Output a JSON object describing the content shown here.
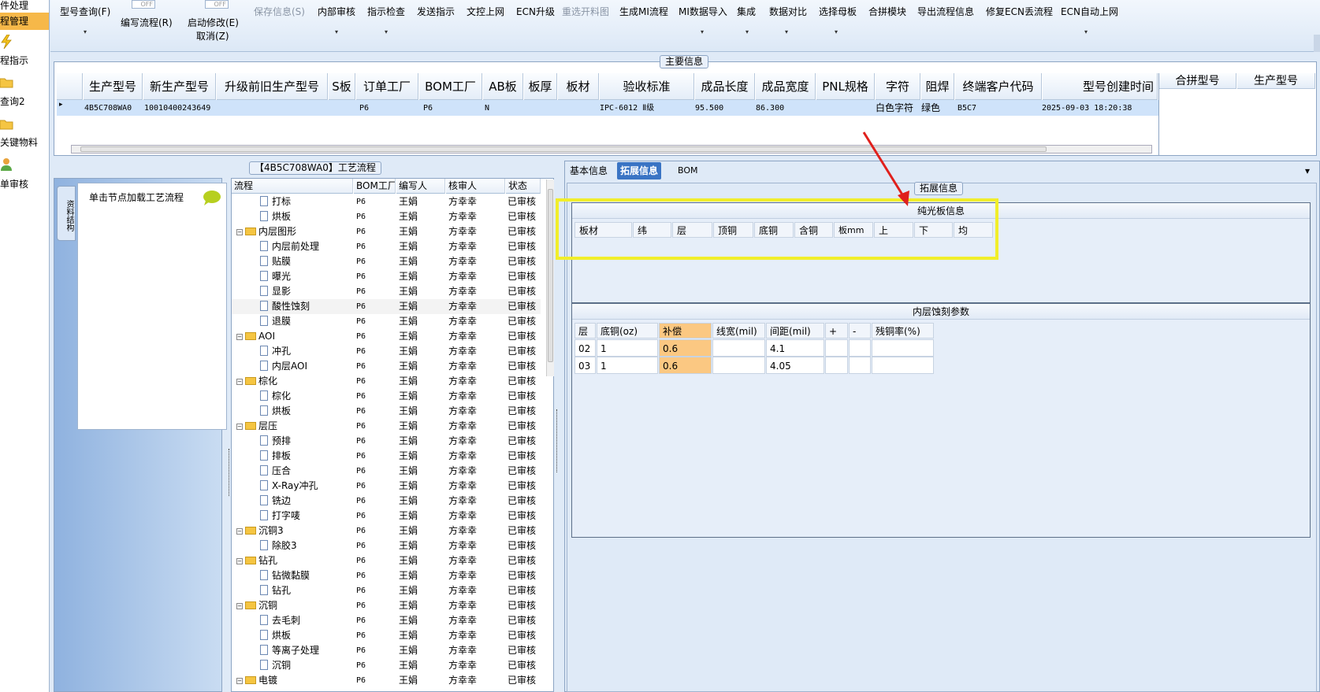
{
  "leftnav": {
    "items": [
      "件处理",
      "程管理",
      "程指示",
      "查询2",
      "关键物料",
      "单审核"
    ]
  },
  "toolbar": {
    "items": [
      {
        "label": "型号查询(F)"
      },
      {
        "label": "OFF"
      },
      {
        "label": "编写流程(R)"
      },
      {
        "label": "OFF"
      },
      {
        "label": "启动修改(E)"
      },
      {
        "label": "取消(Z)"
      },
      {
        "label": "保存信息(S)",
        "disabled": true
      },
      {
        "label": "内部审核"
      },
      {
        "label": "指示检查"
      },
      {
        "label": "发送指示"
      },
      {
        "label": "文控上网"
      },
      {
        "label": "ECN升级"
      },
      {
        "label": "重选开料图",
        "disabled": true
      },
      {
        "label": "生成MI流程"
      },
      {
        "label": "MI数据导入"
      },
      {
        "label": "集成"
      },
      {
        "label": "数据对比"
      },
      {
        "label": "选择母板"
      },
      {
        "label": "合拼模块"
      },
      {
        "label": "导出流程信息"
      },
      {
        "label": "修复ECN丢流程"
      },
      {
        "label": "ECN自动上网"
      }
    ],
    "dropdown_glyph": "▾"
  },
  "main_info": {
    "title": "主要信息",
    "columns": [
      "生产型号",
      "新生产型号",
      "升级前旧生产型号",
      "S板",
      "订单工厂",
      "BOM工厂",
      "AB板",
      "板厚",
      "板材",
      "验收标准",
      "成品长度",
      "成品宽度",
      "PNL规格",
      "字符",
      "阻焊",
      "终端客户代码",
      "型号创建时间"
    ],
    "row": [
      "4B5C708WA0",
      "10010400243649",
      "",
      "",
      "P6",
      "P6",
      "N",
      "",
      "",
      "IPC-6012 Ⅱ级",
      "95.500",
      "86.300",
      "",
      "白色字符",
      "绿色",
      "B5C7",
      "2025-09-03 18:20:38"
    ],
    "row_indicator": "▸",
    "side_columns": [
      "合拼型号",
      "生产型号"
    ]
  },
  "process": {
    "title": "【4B5C708WA0】工艺流程",
    "side_tab": "资料结构",
    "hint": "单击节点加载工艺流程",
    "columns": [
      "流程",
      "BOM工厂",
      "编写人",
      "核审人",
      "状态"
    ],
    "rows": [
      {
        "name": "打标",
        "type": "doc",
        "level": 2,
        "bom": "P6",
        "writer": "王娟",
        "reviewer": "方幸幸",
        "status": "已审核"
      },
      {
        "name": "烘板",
        "type": "doc",
        "level": 2,
        "bom": "P6",
        "writer": "王娟",
        "reviewer": "方幸幸",
        "status": "已审核"
      },
      {
        "name": "内层图形",
        "type": "folder",
        "level": 1,
        "bom": "P6",
        "writer": "王娟",
        "reviewer": "方幸幸",
        "status": "已审核"
      },
      {
        "name": "内层前处理",
        "type": "doc",
        "level": 2,
        "bom": "P6",
        "writer": "王娟",
        "reviewer": "方幸幸",
        "status": "已审核"
      },
      {
        "name": "贴膜",
        "type": "doc",
        "level": 2,
        "bom": "P6",
        "writer": "王娟",
        "reviewer": "方幸幸",
        "status": "已审核"
      },
      {
        "name": "曝光",
        "type": "doc",
        "level": 2,
        "bom": "P6",
        "writer": "王娟",
        "reviewer": "方幸幸",
        "status": "已审核"
      },
      {
        "name": "显影",
        "type": "doc",
        "level": 2,
        "bom": "P6",
        "writer": "王娟",
        "reviewer": "方幸幸",
        "status": "已审核"
      },
      {
        "name": "酸性蚀刻",
        "type": "doc",
        "level": 2,
        "bom": "P6",
        "writer": "王娟",
        "reviewer": "方幸幸",
        "status": "已审核",
        "selected": true
      },
      {
        "name": "退膜",
        "type": "doc",
        "level": 2,
        "bom": "P6",
        "writer": "王娟",
        "reviewer": "方幸幸",
        "status": "已审核"
      },
      {
        "name": "AOI",
        "type": "folder",
        "level": 1,
        "bom": "P6",
        "writer": "王娟",
        "reviewer": "方幸幸",
        "status": "已审核"
      },
      {
        "name": "冲孔",
        "type": "doc",
        "level": 2,
        "bom": "P6",
        "writer": "王娟",
        "reviewer": "方幸幸",
        "status": "已审核"
      },
      {
        "name": "内层AOI",
        "type": "doc",
        "level": 2,
        "bom": "P6",
        "writer": "王娟",
        "reviewer": "方幸幸",
        "status": "已审核"
      },
      {
        "name": "棕化",
        "type": "folder",
        "level": 1,
        "bom": "P6",
        "writer": "王娟",
        "reviewer": "方幸幸",
        "status": "已审核"
      },
      {
        "name": "棕化",
        "type": "doc",
        "level": 2,
        "bom": "P6",
        "writer": "王娟",
        "reviewer": "方幸幸",
        "status": "已审核"
      },
      {
        "name": "烘板",
        "type": "doc",
        "level": 2,
        "bom": "P6",
        "writer": "王娟",
        "reviewer": "方幸幸",
        "status": "已审核"
      },
      {
        "name": "层压",
        "type": "folder",
        "level": 1,
        "bom": "P6",
        "writer": "王娟",
        "reviewer": "方幸幸",
        "status": "已审核"
      },
      {
        "name": "预排",
        "type": "doc",
        "level": 2,
        "bom": "P6",
        "writer": "王娟",
        "reviewer": "方幸幸",
        "status": "已审核"
      },
      {
        "name": "排板",
        "type": "doc",
        "level": 2,
        "bom": "P6",
        "writer": "王娟",
        "reviewer": "方幸幸",
        "status": "已审核"
      },
      {
        "name": "压合",
        "type": "doc",
        "level": 2,
        "bom": "P6",
        "writer": "王娟",
        "reviewer": "方幸幸",
        "status": "已审核"
      },
      {
        "name": "X-Ray冲孔",
        "type": "doc",
        "level": 2,
        "bom": "P6",
        "writer": "王娟",
        "reviewer": "方幸幸",
        "status": "已审核"
      },
      {
        "name": "铣边",
        "type": "doc",
        "level": 2,
        "bom": "P6",
        "writer": "王娟",
        "reviewer": "方幸幸",
        "status": "已审核"
      },
      {
        "name": "打字唛",
        "type": "doc",
        "level": 2,
        "bom": "P6",
        "writer": "王娟",
        "reviewer": "方幸幸",
        "status": "已审核"
      },
      {
        "name": "沉铜3",
        "type": "folder",
        "level": 1,
        "bom": "P6",
        "writer": "王娟",
        "reviewer": "方幸幸",
        "status": "已审核"
      },
      {
        "name": "除胶3",
        "type": "doc",
        "level": 2,
        "bom": "P6",
        "writer": "王娟",
        "reviewer": "方幸幸",
        "status": "已审核"
      },
      {
        "name": "钻孔",
        "type": "folder",
        "level": 1,
        "bom": "P6",
        "writer": "王娟",
        "reviewer": "方幸幸",
        "status": "已审核"
      },
      {
        "name": "钻微黏膜",
        "type": "doc",
        "level": 2,
        "bom": "P6",
        "writer": "王娟",
        "reviewer": "方幸幸",
        "status": "已审核"
      },
      {
        "name": "钻孔",
        "type": "doc",
        "level": 2,
        "bom": "P6",
        "writer": "王娟",
        "reviewer": "方幸幸",
        "status": "已审核"
      },
      {
        "name": "沉铜",
        "type": "folder",
        "level": 1,
        "bom": "P6",
        "writer": "王娟",
        "reviewer": "方幸幸",
        "status": "已审核"
      },
      {
        "name": "去毛刺",
        "type": "doc",
        "level": 2,
        "bom": "P6",
        "writer": "王娟",
        "reviewer": "方幸幸",
        "status": "已审核"
      },
      {
        "name": "烘板",
        "type": "doc",
        "level": 2,
        "bom": "P6",
        "writer": "王娟",
        "reviewer": "方幸幸",
        "status": "已审核"
      },
      {
        "name": "等离子处理",
        "type": "doc",
        "level": 2,
        "bom": "P6",
        "writer": "王娟",
        "reviewer": "方幸幸",
        "status": "已审核"
      },
      {
        "name": "沉铜",
        "type": "doc",
        "level": 2,
        "bom": "P6",
        "writer": "王娟",
        "reviewer": "方幸幸",
        "status": "已审核"
      },
      {
        "name": "电镀",
        "type": "folder",
        "level": 1,
        "bom": "P6",
        "writer": "王娟",
        "reviewer": "方幸幸",
        "status": "已审核"
      }
    ]
  },
  "right": {
    "tabs": [
      {
        "label": "基本信息",
        "active": false
      },
      {
        "label": "拓展信息",
        "active": true
      },
      {
        "label": "BOM",
        "active": false
      }
    ],
    "collapse_glyph": "▾",
    "ext_title": "拓展信息",
    "plate_title": "纯光板信息",
    "plate_columns": [
      "板材",
      "纬",
      "层",
      "顶铜",
      "底铜",
      "含铜",
      "板mm",
      "上",
      "下",
      "均"
    ],
    "etch_title": "内层蚀刻参数",
    "etch_columns": [
      "层",
      "底铜(oz)",
      "补偿",
      "线宽(mil)",
      "间距(mil)",
      "+",
      "-",
      "残铜率(%)"
    ],
    "etch_rows": [
      [
        "02",
        "1",
        "0.6",
        "",
        "4.1",
        "",
        "",
        ""
      ],
      [
        "03",
        "1",
        "0.6",
        "",
        "4.05",
        "",
        "",
        ""
      ]
    ]
  },
  "colors": {
    "accent_tab": "#3a74c4",
    "highlight": "#fbc882",
    "annotation_box": "#f1ee2a",
    "annotation_arrow": "#e0201c",
    "selected_row": "#cfe3fa"
  }
}
